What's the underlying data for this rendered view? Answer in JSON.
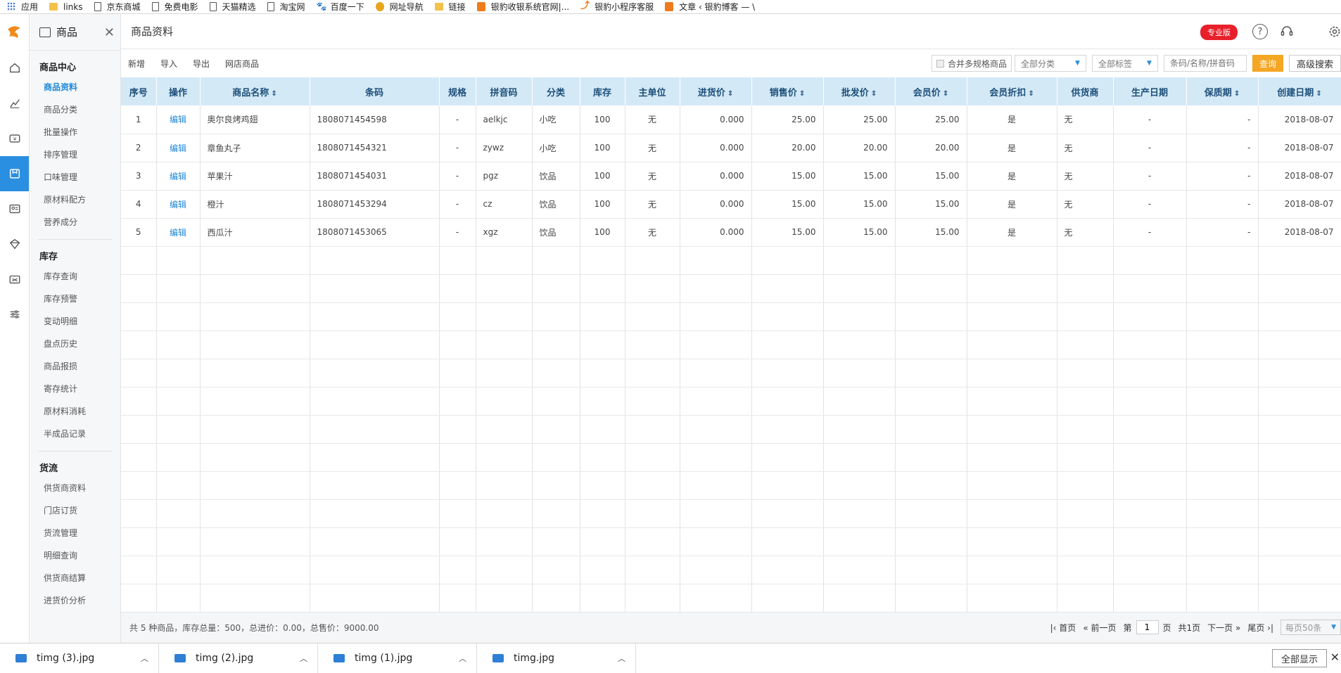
{
  "bookmarks": [
    {
      "label": "应用",
      "icon": "apps-icon"
    },
    {
      "label": "links",
      "icon": "folder-icon"
    },
    {
      "label": "京东商城",
      "icon": "page-icon"
    },
    {
      "label": "免费电影",
      "icon": "page-icon"
    },
    {
      "label": "天猫精选",
      "icon": "page-icon"
    },
    {
      "label": "淘宝网",
      "icon": "page-icon"
    },
    {
      "label": "百度一下",
      "icon": "paw-icon"
    },
    {
      "label": "网址导航",
      "icon": "hao-icon"
    },
    {
      "label": "链接",
      "icon": "folder-icon"
    },
    {
      "label": "银豹收银系统官网|...",
      "icon": "orange-icon"
    },
    {
      "label": "银豹小程序客服",
      "icon": "bao-icon"
    },
    {
      "label": "文章 ‹ 银豹博客 — \\",
      "icon": "orange-icon"
    }
  ],
  "rail": {
    "icons": [
      "home-icon",
      "chart-icon",
      "money-icon",
      "product-icon",
      "member-icon",
      "gift-icon",
      "promo-icon",
      "settings-sliders-icon"
    ],
    "active_index": 3
  },
  "sidebar": {
    "title": "商品",
    "groups": [
      {
        "label": "商品中心",
        "items": [
          "商品资料",
          "商品分类",
          "批量操作",
          "排序管理",
          "口味管理",
          "原材料配方",
          "营养成分"
        ]
      },
      {
        "label": "库存",
        "items": [
          "库存查询",
          "库存预警",
          "变动明细",
          "盘点历史",
          "商品报损",
          "寄存统计",
          "原材料消耗",
          "半成品记录"
        ]
      },
      {
        "label": "货流",
        "items": [
          "供货商资料",
          "门店订货",
          "货流管理",
          "明细查询",
          "供货商结算",
          "进货价分析"
        ]
      }
    ],
    "active_item": "商品资料"
  },
  "topbar": {
    "title": "商品资料",
    "badge": "专业版"
  },
  "toolbar": {
    "actions": [
      "新增",
      "导入",
      "导出",
      "网店商品"
    ],
    "merge_label": "合并多规格商品",
    "category_select": "全部分类",
    "tag_select": "全部标签",
    "search_placeholder": "条码/名称/拼音码",
    "query_label": "查询",
    "advanced_label": "高级搜索"
  },
  "table": {
    "columns": [
      "序号",
      "操作",
      "商品名称",
      "条码",
      "规格",
      "拼音码",
      "分类",
      "库存",
      "主单位",
      "进货价",
      "销售价",
      "批发价",
      "会员价",
      "会员折扣",
      "供货商",
      "生产日期",
      "保质期",
      "创建日期"
    ],
    "sortable": [
      false,
      false,
      true,
      false,
      false,
      false,
      false,
      false,
      false,
      true,
      true,
      true,
      true,
      true,
      false,
      false,
      true,
      true
    ],
    "rows": [
      [
        "1",
        "编辑",
        "奥尔良烤鸡翅",
        "1808071454598",
        "-",
        "aelkjc",
        "小吃",
        "100",
        "无",
        "0.000",
        "25.00",
        "25.00",
        "25.00",
        "是",
        "无",
        "-",
        "-",
        "2018-08-07"
      ],
      [
        "2",
        "编辑",
        "章鱼丸子",
        "1808071454321",
        "-",
        "zywz",
        "小吃",
        "100",
        "无",
        "0.000",
        "20.00",
        "20.00",
        "20.00",
        "是",
        "无",
        "-",
        "-",
        "2018-08-07"
      ],
      [
        "3",
        "编辑",
        "苹果汁",
        "1808071454031",
        "-",
        "pgz",
        "饮品",
        "100",
        "无",
        "0.000",
        "15.00",
        "15.00",
        "15.00",
        "是",
        "无",
        "-",
        "-",
        "2018-08-07"
      ],
      [
        "4",
        "编辑",
        "橙汁",
        "1808071453294",
        "-",
        "cz",
        "饮品",
        "100",
        "无",
        "0.000",
        "15.00",
        "15.00",
        "15.00",
        "是",
        "无",
        "-",
        "-",
        "2018-08-07"
      ],
      [
        "5",
        "编辑",
        "西瓜汁",
        "1808071453065",
        "-",
        "xgz",
        "饮品",
        "100",
        "无",
        "0.000",
        "15.00",
        "15.00",
        "15.00",
        "是",
        "无",
        "-",
        "-",
        "2018-08-07"
      ]
    ],
    "empty_rows": 13
  },
  "footer": {
    "summary": "共 5 种商品，库存总量：500，总进价：0.00，总售价：9000.00",
    "first": "首页",
    "prev": "前一页",
    "page_prefix": "第",
    "page_value": "1",
    "page_suffix": "页",
    "total_pages": "共1页",
    "next": "下一页",
    "last": "尾页",
    "page_size": "每页50条"
  },
  "downloads": {
    "files": [
      "timg (3).jpg",
      "timg (2).jpg",
      "timg (1).jpg",
      "timg.jpg"
    ],
    "show_all": "全部显示"
  },
  "colors": {
    "accent": "#2a8fe0",
    "header_bg": "#d4e9f6",
    "query_btn": "#f5a623",
    "badge": "#e8202a",
    "logo": "#f08a1c"
  }
}
